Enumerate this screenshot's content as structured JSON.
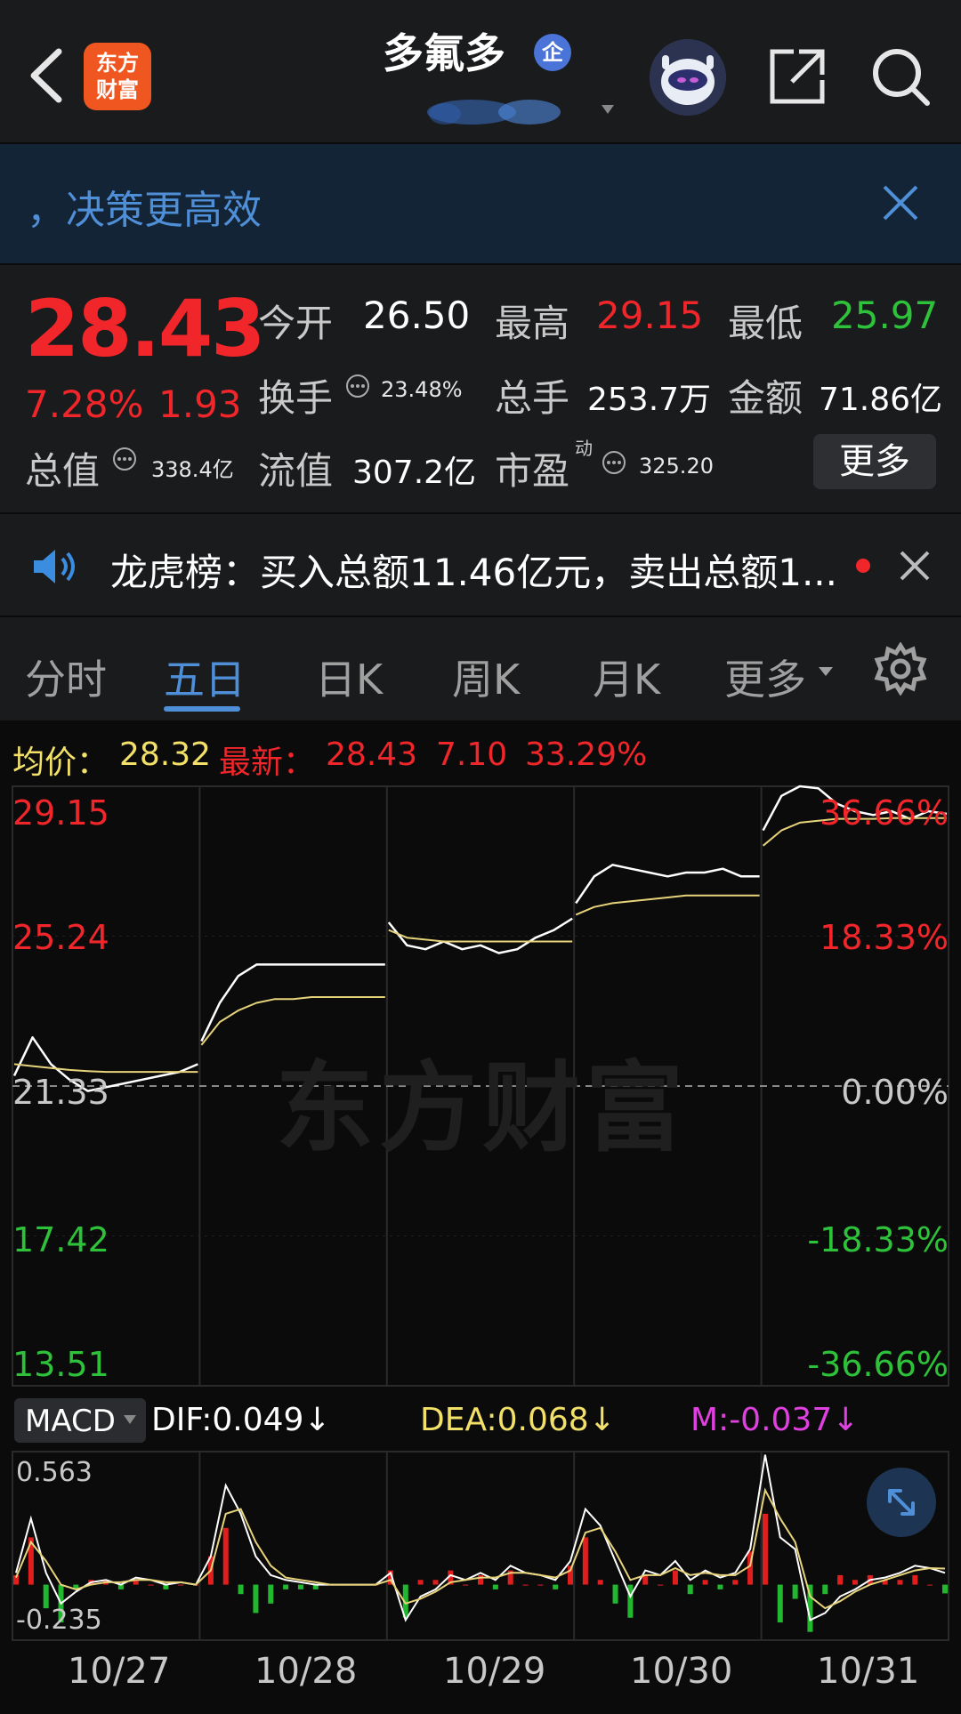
{
  "header": {
    "logo_line1": "东方",
    "logo_line2": "财富",
    "title": "多氟多",
    "title_badge": "企",
    "icons": [
      "back-icon",
      "robot-avatar-icon",
      "share-icon",
      "search-icon"
    ]
  },
  "banner": {
    "text": "，决策更高效"
  },
  "quote": {
    "price": "28.43",
    "change_pct": "7.28%",
    "change_amt": "1.93",
    "open_label": "今开",
    "open": "26.50",
    "high_label": "最高",
    "high": "29.15",
    "low_label": "最低",
    "low": "25.97",
    "turnover_label": "换手",
    "turnover": "23.48%",
    "volume_label": "总手",
    "volume": "253.7万",
    "amount_label": "金额",
    "amount": "71.86亿",
    "mktcap_label": "总值",
    "mktcap": "338.4亿",
    "float_label": "流值",
    "float": "307.2亿",
    "pe_label": "市盈",
    "pe_sup": "动",
    "pe": "325.20",
    "more_button": "更多"
  },
  "news": {
    "text": "龙虎榜：买入总额11.46亿元，卖出总额1..."
  },
  "tabs": [
    {
      "label": "分时",
      "active": false
    },
    {
      "label": "五日",
      "active": true
    },
    {
      "label": "日K",
      "active": false
    },
    {
      "label": "周K",
      "active": false
    },
    {
      "label": "月K",
      "active": false
    },
    {
      "label": "更多",
      "active": false
    }
  ],
  "info_line": {
    "avg_label": "均价：",
    "avg": "28.32",
    "latest_label": "最新：",
    "latest": "28.43",
    "latest_chg": "7.10",
    "latest_pct": "33.29%"
  },
  "chart_data": {
    "type": "line",
    "y_left_labels": [
      "29.15",
      "25.24",
      "21.33",
      "17.42",
      "13.51"
    ],
    "y_right_labels": [
      "36.66%",
      "18.33%",
      "0.00%",
      "-18.33%",
      "-36.66%"
    ],
    "ylim": [
      13.51,
      29.15
    ],
    "base": 21.33,
    "watermark": "东方财富",
    "x_labels": [
      "10/27",
      "10/28",
      "10/29",
      "10/30",
      "10/31"
    ],
    "series": [
      {
        "color": "#ffffff",
        "days": [
          [
            21.6,
            22.6,
            21.9,
            21.5,
            21.2,
            21.3,
            21.4,
            21.5,
            21.6,
            21.7,
            21.9
          ],
          [
            22.5,
            23.5,
            24.2,
            24.5,
            24.5,
            24.5,
            24.5,
            24.5,
            24.5,
            24.5,
            24.5
          ],
          [
            25.6,
            25.0,
            24.9,
            25.1,
            24.9,
            25.0,
            24.8,
            24.9,
            25.2,
            25.4,
            25.7
          ],
          [
            26.1,
            26.8,
            27.1,
            27.0,
            26.9,
            26.8,
            26.9,
            26.9,
            27.0,
            26.8,
            26.8
          ],
          [
            28.0,
            28.9,
            29.15,
            29.1,
            28.7,
            28.5,
            28.4,
            28.5,
            28.3,
            28.5,
            28.43
          ]
        ]
      },
      {
        "color": "#e7d37a",
        "days": [
          [
            21.9,
            21.85,
            21.8,
            21.75,
            21.72,
            21.7,
            21.7,
            21.7,
            21.7,
            21.7,
            21.7
          ],
          [
            22.4,
            23.0,
            23.3,
            23.5,
            23.6,
            23.6,
            23.65,
            23.65,
            23.65,
            23.65,
            23.65
          ],
          [
            25.4,
            25.2,
            25.15,
            25.1,
            25.1,
            25.1,
            25.1,
            25.1,
            25.1,
            25.1,
            25.1
          ],
          [
            25.8,
            26.0,
            26.1,
            26.15,
            26.2,
            26.25,
            26.3,
            26.3,
            26.3,
            26.3,
            26.3
          ],
          [
            27.6,
            28.0,
            28.2,
            28.25,
            28.3,
            28.3,
            28.3,
            28.32,
            28.32,
            28.32,
            28.32
          ]
        ]
      }
    ]
  },
  "macd": {
    "selector": "MACD",
    "dif_label": "DIF:0.049↓",
    "dea_label": "DEA:0.068↓",
    "m_label": "M:-0.037↓",
    "ymax_label": "0.563",
    "ymin_label": "-0.235",
    "ylim": [
      -0.235,
      0.563
    ],
    "dif": [
      0.05,
      0.28,
      0.05,
      -0.08,
      -0.03,
      0.01,
      0.02,
      0.0,
      0.03,
      0.02,
      0.0,
      0.01,
      0.0,
      0.12,
      0.42,
      0.3,
      0.12,
      0.04,
      0.02,
      0.01,
      0.0,
      0.0,
      0.0,
      0.0,
      0.0,
      0.05,
      -0.15,
      -0.05,
      -0.02,
      0.04,
      0.02,
      0.05,
      0.02,
      0.08,
      0.05,
      0.04,
      0.02,
      0.1,
      0.32,
      0.25,
      0.1,
      -0.05,
      0.06,
      0.04,
      0.1,
      0.02,
      0.06,
      0.03,
      0.05,
      0.15,
      0.55,
      0.2,
      0.15,
      -0.15,
      -0.12,
      -0.05,
      -0.02,
      0.02,
      0.03,
      0.05,
      0.08,
      0.07,
      0.05
    ],
    "dea": [
      0.03,
      0.18,
      0.1,
      0.0,
      -0.02,
      0.0,
      0.01,
      0.01,
      0.02,
      0.02,
      0.01,
      0.01,
      0.0,
      0.06,
      0.3,
      0.32,
      0.18,
      0.08,
      0.03,
      0.02,
      0.01,
      0.0,
      0.0,
      0.0,
      0.0,
      0.02,
      -0.08,
      -0.06,
      -0.03,
      0.01,
      0.02,
      0.03,
      0.03,
      0.05,
      0.05,
      0.04,
      0.03,
      0.06,
      0.22,
      0.24,
      0.14,
      0.02,
      0.04,
      0.04,
      0.07,
      0.04,
      0.05,
      0.04,
      0.04,
      0.08,
      0.4,
      0.28,
      0.18,
      -0.05,
      -0.1,
      -0.07,
      -0.03,
      0.0,
      0.02,
      0.04,
      0.06,
      0.07,
      0.068
    ],
    "hist": [
      0.04,
      0.2,
      -0.1,
      -0.16,
      -0.02,
      0.02,
      0.02,
      -0.02,
      0.02,
      0.0,
      -0.02,
      0.0,
      0.0,
      0.12,
      0.24,
      -0.04,
      -0.12,
      -0.08,
      -0.02,
      -0.02,
      -0.02,
      0.0,
      0.0,
      0.0,
      0.0,
      0.06,
      -0.14,
      0.02,
      0.02,
      0.06,
      0.0,
      0.04,
      -0.02,
      0.06,
      0.0,
      0.0,
      -0.02,
      0.08,
      0.2,
      0.02,
      -0.08,
      -0.14,
      0.04,
      0.0,
      0.06,
      -0.04,
      0.02,
      -0.02,
      0.02,
      0.14,
      0.3,
      -0.16,
      -0.06,
      -0.2,
      -0.04,
      0.04,
      0.02,
      0.04,
      0.02,
      0.02,
      0.04,
      0.0,
      -0.037
    ]
  }
}
